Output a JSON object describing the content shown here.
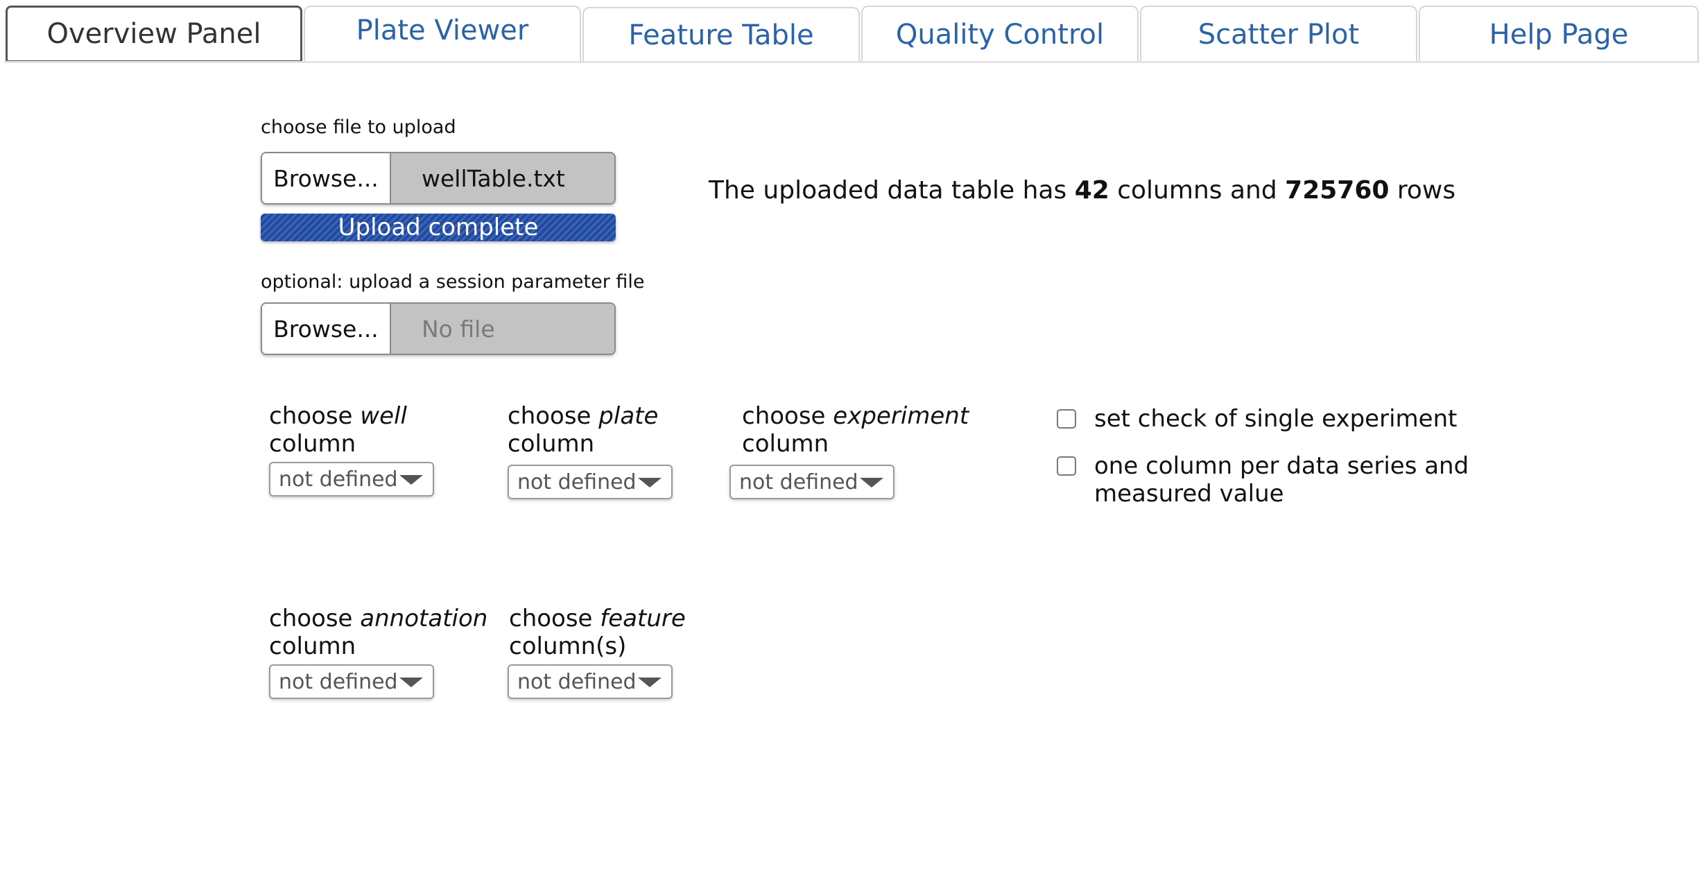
{
  "tabs": [
    {
      "label": "Overview Panel",
      "active": true
    },
    {
      "label": "Plate Viewer",
      "active": false
    },
    {
      "label": "Feature Table",
      "active": false
    },
    {
      "label": "Quality Control",
      "active": false
    },
    {
      "label": "Scatter Plot",
      "active": false
    },
    {
      "label": "Help Page",
      "active": false
    }
  ],
  "upload": {
    "label": "choose file to upload",
    "browse_label": "Browse...",
    "file_name": "wellTable.txt",
    "progress_text": "Upload complete",
    "progress_percent": 100
  },
  "session_upload": {
    "label": "optional: upload a session parameter file",
    "browse_label": "Browse...",
    "file_name": "No file"
  },
  "summary": {
    "prefix": "The uploaded data table has ",
    "columns": "42",
    "middle": " columns and ",
    "rows": "725760",
    "suffix": " rows"
  },
  "selects": {
    "well": {
      "pre": "choose ",
      "emph": "well",
      "post": "column",
      "value": "not defined"
    },
    "plate": {
      "pre": "choose ",
      "emph": "plate",
      "post": "column",
      "value": "not defined"
    },
    "experiment": {
      "pre": "choose ",
      "emph": "experiment",
      "post": "column",
      "value": "not defined"
    },
    "annotation": {
      "pre": "choose ",
      "emph": "annotation",
      "post": "column",
      "value": "not defined"
    },
    "feature": {
      "pre": "choose ",
      "emph": "feature",
      "post": "column(s)",
      "value": "not defined"
    }
  },
  "checkboxes": {
    "single_experiment": {
      "line1": "set check of single experiment",
      "checked": false
    },
    "per_series": {
      "line1": "one column per data series and",
      "line2": "measured value",
      "checked": false
    }
  },
  "colors": {
    "tab_text": "#2b63a8",
    "progress_bar": "#1f4aa3"
  }
}
